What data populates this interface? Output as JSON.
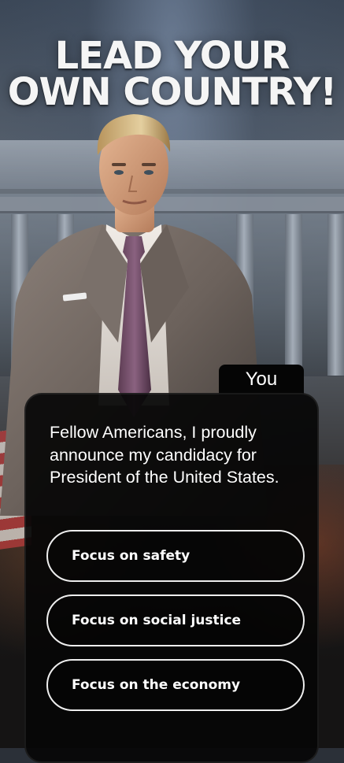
{
  "headline": {
    "line1": "LEAD YOUR",
    "line2": "OWN COUNTRY!"
  },
  "dialog": {
    "speaker": "You",
    "message": "Fellow Americans, I proudly announce my candidacy for President of the United States."
  },
  "choices": [
    {
      "label": "Focus on safety"
    },
    {
      "label": "Focus on social justice"
    },
    {
      "label": "Focus on the economy"
    }
  ]
}
